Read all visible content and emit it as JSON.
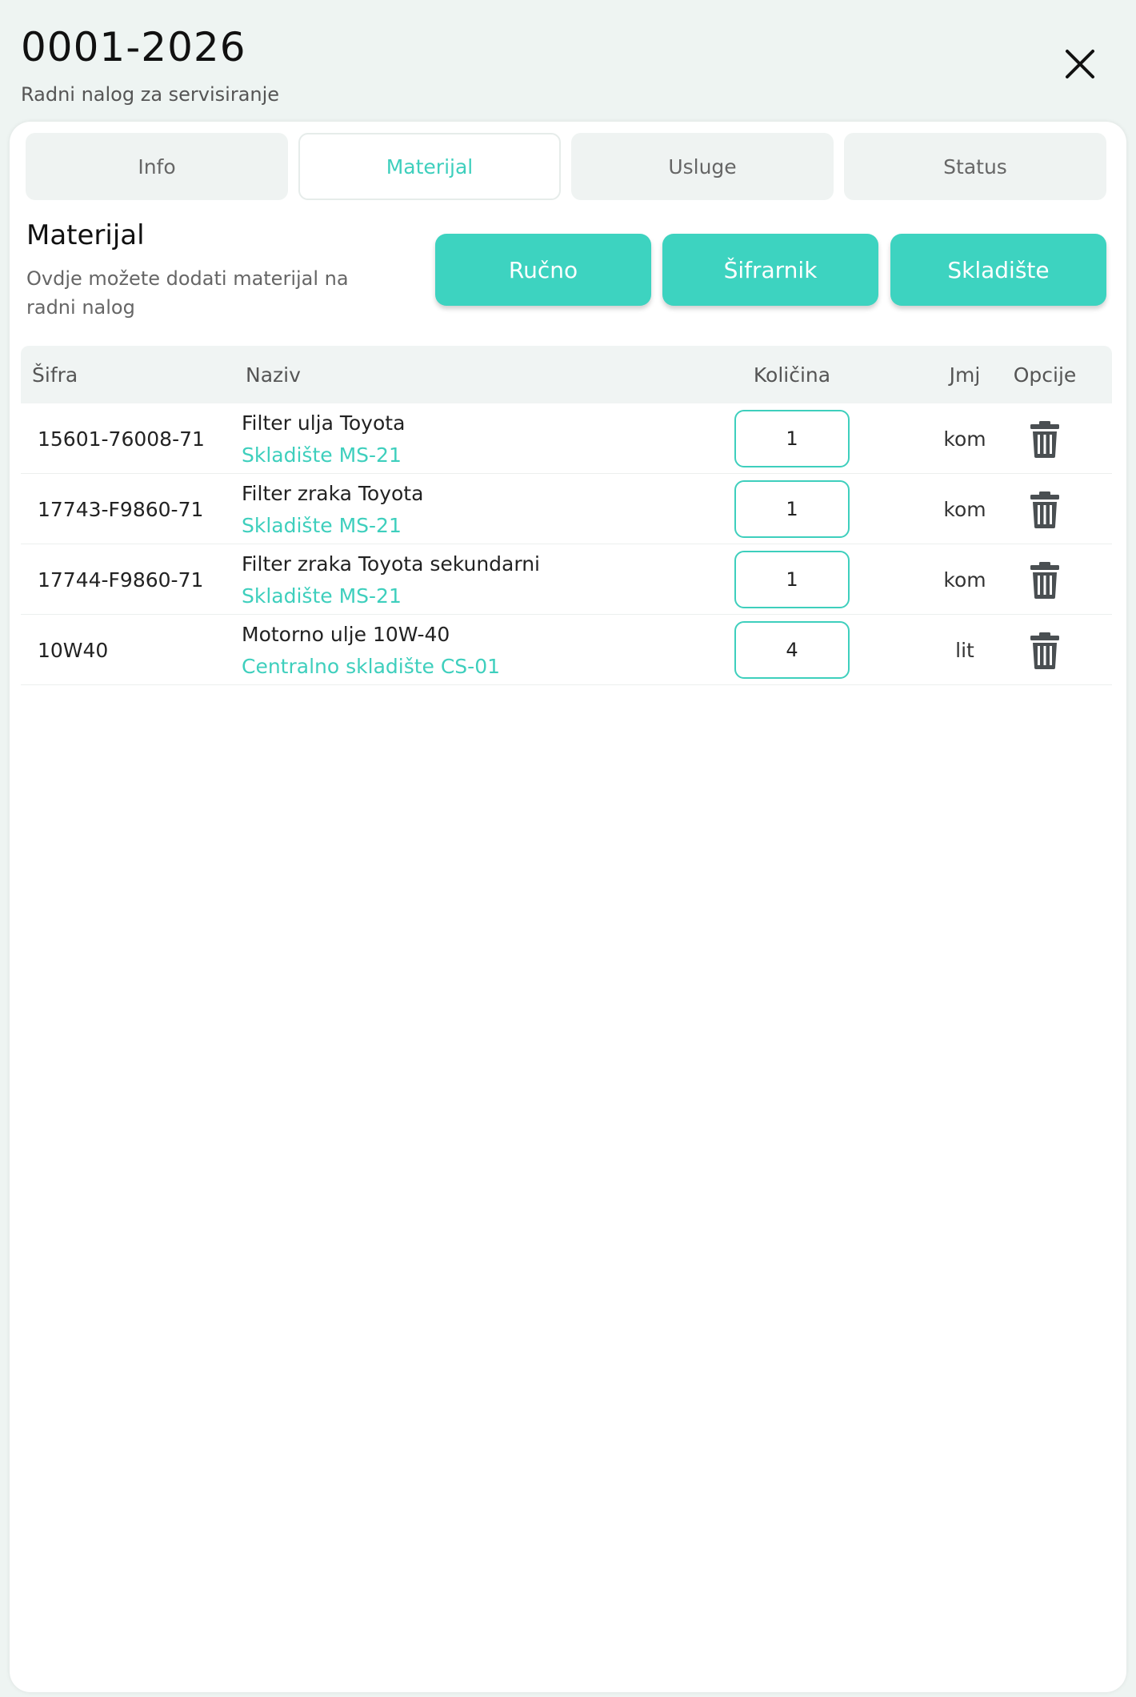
{
  "header": {
    "title": "0001-2026",
    "subtitle": "Radni nalog za servisiranje"
  },
  "tabs": [
    {
      "label": "Info",
      "active": false
    },
    {
      "label": "Materijal",
      "active": true
    },
    {
      "label": "Usluge",
      "active": false
    },
    {
      "label": "Status",
      "active": false
    }
  ],
  "section": {
    "title": "Materijal",
    "description": "Ovdje možete dodati materijal na radni nalog"
  },
  "actions": {
    "manual": "Ručno",
    "catalog": "Šifrarnik",
    "warehouse": "Skladište"
  },
  "table": {
    "columns": {
      "code": "Šifra",
      "name": "Naziv",
      "quantity": "Količina",
      "unit": "Jmj",
      "options": "Opcije"
    },
    "rows": [
      {
        "code": "15601-76008-71",
        "name": "Filter ulja Toyota",
        "location": "Skladište MS-21",
        "quantity": "1",
        "unit": "kom"
      },
      {
        "code": "17743-F9860-71",
        "name": "Filter zraka Toyota",
        "location": "Skladište MS-21",
        "quantity": "1",
        "unit": "kom"
      },
      {
        "code": "17744-F9860-71",
        "name": "Filter zraka Toyota sekundarni",
        "location": "Skladište MS-21",
        "quantity": "1",
        "unit": "kom"
      },
      {
        "code": "10W40",
        "name": "Motorno ulje 10W-40",
        "location": "Centralno skladište CS-01",
        "quantity": "4",
        "unit": "lit"
      }
    ]
  },
  "colors": {
    "accent": "#3dd3c0",
    "background": "#eef4f2",
    "icon": "#4a4f52"
  },
  "icons": {
    "close": "close-icon",
    "delete": "trash-icon"
  }
}
